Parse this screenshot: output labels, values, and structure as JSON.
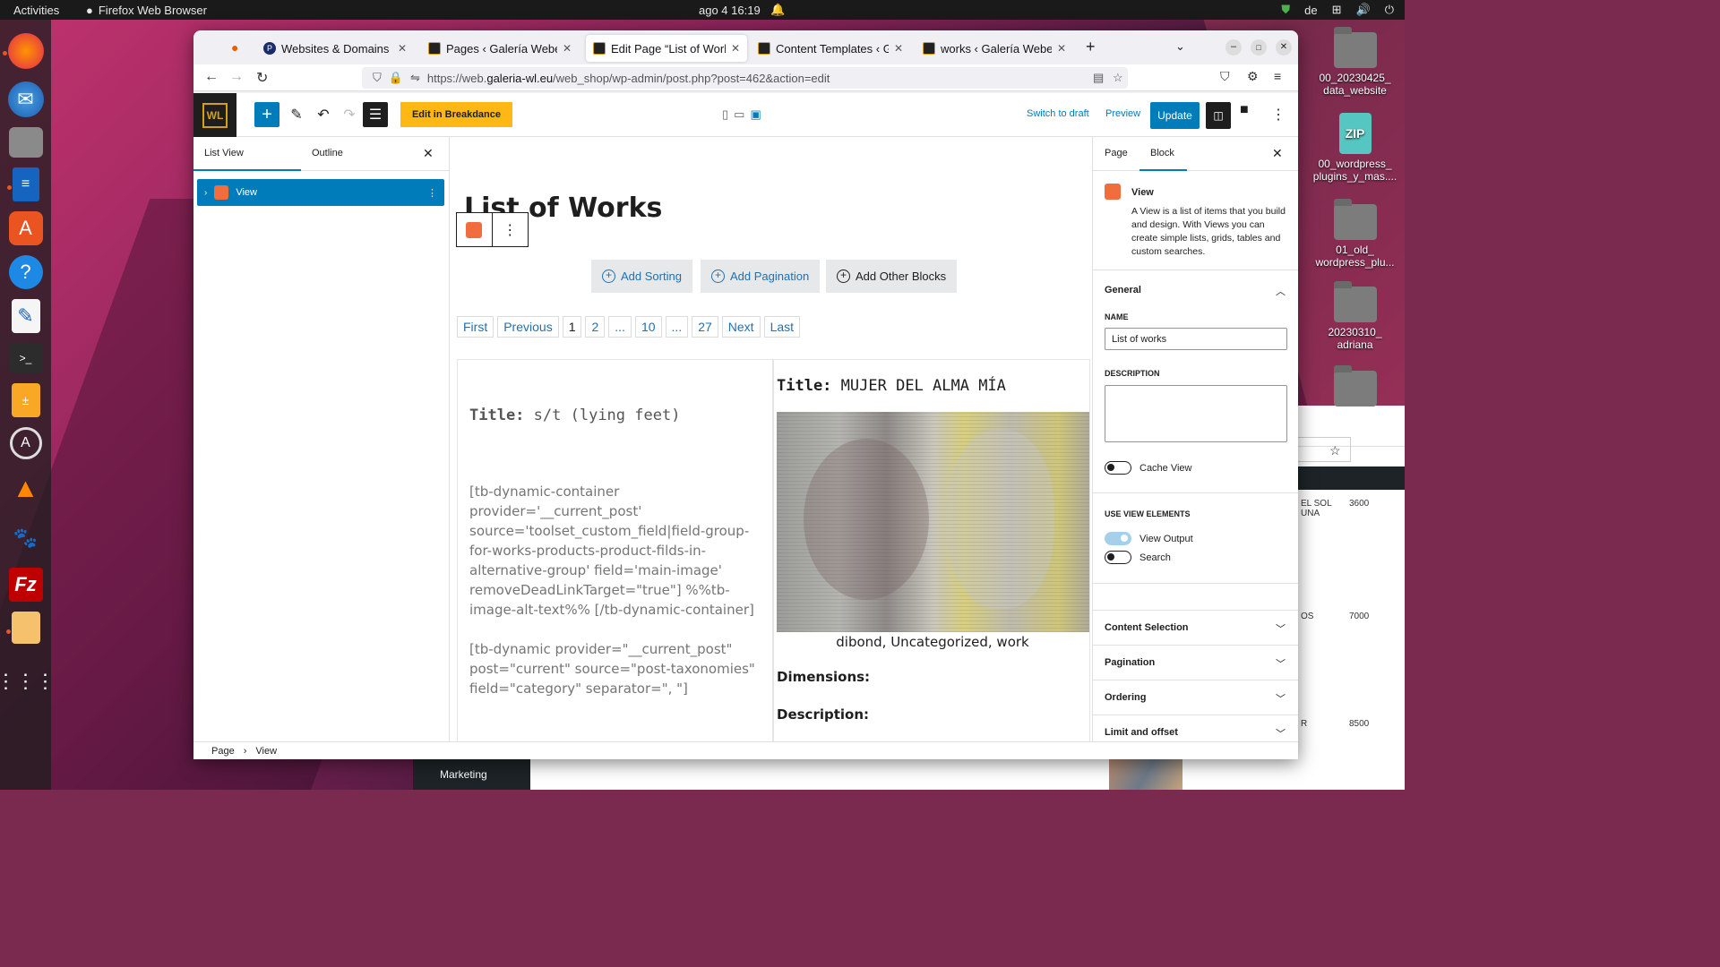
{
  "topbar": {
    "activities": "Activities",
    "app_name": "Firefox Web Browser",
    "clock": "ago 4  16:19",
    "lang": "de"
  },
  "dock": {
    "items": [
      "firefox-icon",
      "thunderbird-icon",
      "files-icon",
      "writer-icon",
      "app-center-icon",
      "help-icon",
      "text-editor-icon",
      "terminal-icon",
      "calculator-icon",
      "software-updater-icon",
      "vlc-icon",
      "gimp-icon",
      "filezilla-icon",
      "image-viewer-icon",
      "app-grid-icon"
    ]
  },
  "desktop_icons": [
    {
      "label": "00_20230425_\ndata_website",
      "type": "folder"
    },
    {
      "label": "00_wordpress_\nplugins_y_mas....",
      "type": "zip"
    },
    {
      "label": "01_old_\nwordpress_plu...",
      "type": "folder"
    },
    {
      "label": "20230310_\nadriana",
      "type": "folder"
    }
  ],
  "background_window": {
    "rows": [
      {
        "name": "EL SOL\nUNA",
        "value": "3600"
      },
      {
        "name": "OS",
        "value": "7000"
      },
      {
        "name": "R",
        "value": "8500"
      }
    ],
    "marketing": "Marketing"
  },
  "browser": {
    "tabs": [
      {
        "label": "Websites & Domains - Ple"
      },
      {
        "label": "Pages ‹ Galería Weber-Lu"
      },
      {
        "label": "Edit Page “List of Works”"
      },
      {
        "label": "Content Templates ‹ Gale"
      },
      {
        "label": "works ‹ Galería Weber-Lu"
      }
    ],
    "url_prefix": "https://web.",
    "url_host": "galeria-wl.eu",
    "url_path": "/web_shop/wp-admin/post.php?post=462&action=edit"
  },
  "editor": {
    "logo": "WL",
    "breakdance": "Edit in Breakdance",
    "switch_draft": "Switch to draft",
    "preview": "Preview",
    "update": "Update"
  },
  "list_panel": {
    "tab_list": "List View",
    "tab_outline": "Outline",
    "item": "View"
  },
  "content": {
    "page_title": "List of Works",
    "buttons": [
      "Add Sorting",
      "Add Pagination",
      "Add Other Blocks"
    ],
    "pagination": [
      "First",
      "Previous",
      "1",
      "2",
      "...",
      "10",
      "...",
      "27",
      "Next",
      "Last"
    ],
    "item1": {
      "title_label": "Title:",
      "title_value": "s/t (lying feet)",
      "shortcode1": "[tb-dynamic-container provider='__current_post' source='toolset_custom_field|field-group-for-works-products-product-filds-in-alternative-group' field='main-image' removeDeadLinkTarget=\"true\"] %%tb-image-alt-text%% [/tb-dynamic-container]",
      "shortcode2": "[tb-dynamic provider=\"__current_post\" post=\"current\" source=\"post-taxonomies\" field=\"category\" separator=\", \"]"
    },
    "item2": {
      "title_label": "Title:",
      "title_value": "MUJER DEL ALMA MÍA",
      "categories": "dibond, Uncategorized, work",
      "dimensions": "Dimensions:",
      "description": "Description:"
    }
  },
  "sidebar": {
    "tab_page": "Page",
    "tab_block": "Block",
    "block_name": "View",
    "block_desc": "A View is a list of items that you build and design. With Views you can create simple lists, grids, tables and custom searches.",
    "general": "General",
    "name_label": "NAME",
    "name_value": "List of works",
    "description_label": "DESCRIPTION",
    "cache_view": "Cache View",
    "use_view_elements": "USE VIEW ELEMENTS",
    "view_output": "View Output",
    "search": "Search",
    "sections": [
      "Content Selection",
      "Pagination",
      "Ordering",
      "Limit and offset"
    ]
  },
  "footer": {
    "crumb1": "Page",
    "crumb2": "View"
  }
}
